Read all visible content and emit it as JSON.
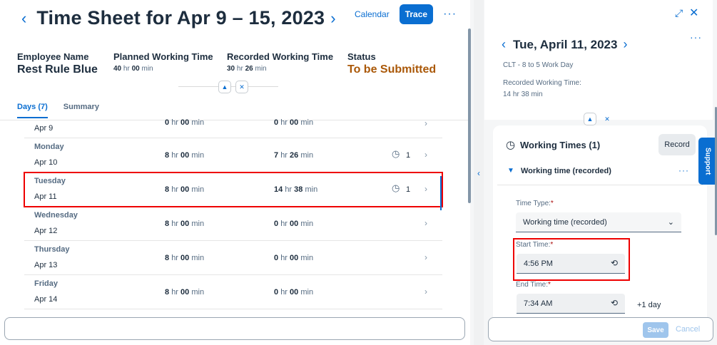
{
  "header": {
    "prev_arrow": "‹",
    "title": "Time Sheet for Apr 9 – 15, 2023",
    "next_arrow": "›",
    "calendar": "Calendar",
    "trace": "Trace",
    "more": "···"
  },
  "kpis": {
    "employee_label": "Employee Name",
    "employee_value": "Rest Rule Blue",
    "planned_label": "Planned Working Time",
    "planned_hr": "40",
    "planned_min": "00",
    "recorded_label": "Recorded Working Time",
    "recorded_hr": "30",
    "recorded_min": "26",
    "status_label": "Status",
    "status_value": "To be Submitted"
  },
  "units": {
    "hr": "hr",
    "min": "min"
  },
  "tabs": [
    {
      "label": "Days (7)"
    },
    {
      "label": "Summary"
    }
  ],
  "rows": [
    {
      "name": "",
      "date": "Apr 9",
      "planned_hr": "0",
      "planned_min": "00",
      "recorded_hr": "0",
      "recorded_min": "00",
      "count": ""
    },
    {
      "name": "Monday",
      "date": "Apr 10",
      "planned_hr": "8",
      "planned_min": "00",
      "recorded_hr": "7",
      "recorded_min": "26",
      "count": "1"
    },
    {
      "name": "Tuesday",
      "date": "Apr 11",
      "planned_hr": "8",
      "planned_min": "00",
      "recorded_hr": "14",
      "recorded_min": "38",
      "count": "1"
    },
    {
      "name": "Wednesday",
      "date": "Apr 12",
      "planned_hr": "8",
      "planned_min": "00",
      "recorded_hr": "0",
      "recorded_min": "00",
      "count": ""
    },
    {
      "name": "Thursday",
      "date": "Apr 13",
      "planned_hr": "8",
      "planned_min": "00",
      "recorded_hr": "0",
      "recorded_min": "00",
      "count": ""
    },
    {
      "name": "Friday",
      "date": "Apr 14",
      "planned_hr": "8",
      "planned_min": "00",
      "recorded_hr": "0",
      "recorded_min": "00",
      "count": ""
    }
  ],
  "detail": {
    "prev_arrow": "‹",
    "title": "Tue, April 11, 2023",
    "next_arrow": "›",
    "subtitle": "CLT - 8 to 5 Work Day",
    "recorded_label": "Recorded Working Time:",
    "recorded_value": "14 hr 38 min",
    "card_title": "Working Times (1)",
    "record_button": "Record",
    "support": "Support",
    "section_title": "Working time (recorded)",
    "time_type_label": "Time Type:",
    "time_type_value": "Working time (recorded)",
    "start_label": "Start Time:",
    "start_value": "4:56 PM",
    "end_label": "End Time:",
    "end_value": "7:34 AM",
    "plus_day": "+1 day",
    "required_mark": "*",
    "save": "Save",
    "cancel": "Cancel"
  },
  "colors": {
    "accent": "#0a6ed1",
    "status": "#aa5808",
    "highlight": "#e00000"
  }
}
